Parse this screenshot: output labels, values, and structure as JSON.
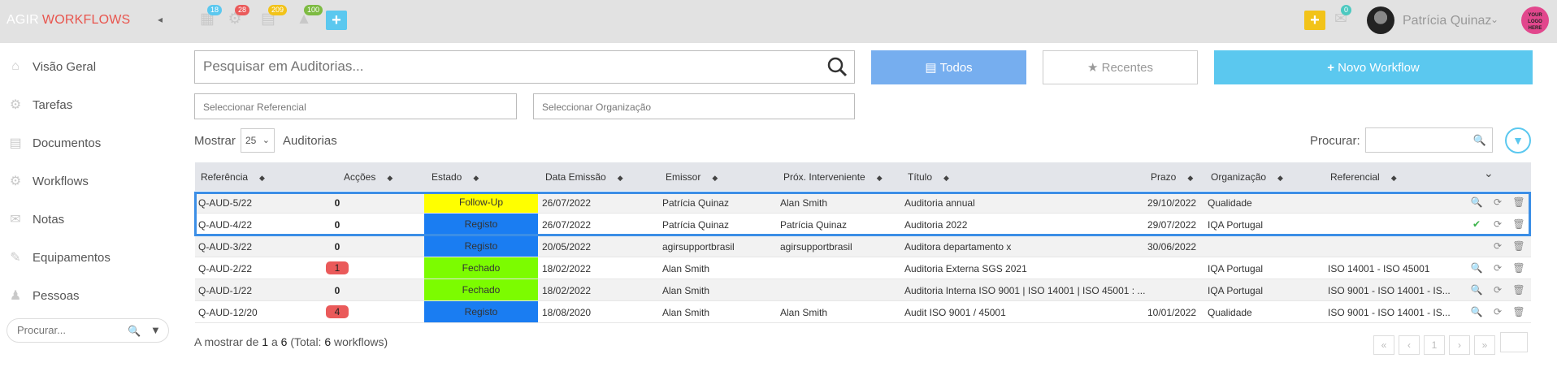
{
  "app": {
    "brand_left": "AGIR",
    "brand_right": "WORKFLOWS",
    "collapse_glyph": "◂"
  },
  "topbar": {
    "icons": [
      {
        "name": "calendar-icon",
        "glyph": "▦",
        "badge": "18",
        "badge_color": "#5bc8ef"
      },
      {
        "name": "gear-icon",
        "glyph": "⚙",
        "badge": "28",
        "badge_color": "#ea5a5a"
      },
      {
        "name": "document-icon",
        "glyph": "▤",
        "badge": "209",
        "badge_color": "#f2c319"
      },
      {
        "name": "bell-icon",
        "glyph": "▲",
        "badge": "100",
        "badge_color": "#7dbb42"
      }
    ],
    "add_glyph": "+",
    "right_add_glyph": "+",
    "mail_badge": "0",
    "user_name": "Patrícia Quinaz",
    "logo_text": "YOUR LOGO HERE"
  },
  "sidebar": {
    "items": [
      {
        "label": "Visão Geral",
        "icon": "home-icon",
        "glyph": "⌂"
      },
      {
        "label": "Tarefas",
        "icon": "gear-icon",
        "glyph": "⚙"
      },
      {
        "label": "Documentos",
        "icon": "file-icon",
        "glyph": "▤"
      },
      {
        "label": "Workflows",
        "icon": "gears-icon",
        "glyph": "⚙"
      },
      {
        "label": "Notas",
        "icon": "comments-icon",
        "glyph": "✉"
      },
      {
        "label": "Equipamentos",
        "icon": "wrench-icon",
        "glyph": "✎"
      },
      {
        "label": "Pessoas",
        "icon": "user-icon",
        "glyph": "♟"
      }
    ],
    "search_placeholder": "Procurar..."
  },
  "toolbar": {
    "search_placeholder": "Pesquisar em Auditorias...",
    "todos_label": "Todos",
    "recentes_label": "Recentes",
    "novo_label": "Novo Workflow",
    "referencial_placeholder": "Seleccionar Referencial",
    "organizacao_placeholder": "Seleccionar Organização"
  },
  "list_controls": {
    "show_label": "Mostrar",
    "page_size": "25",
    "entity_label": "Auditorias",
    "search_label": "Procurar:"
  },
  "table": {
    "headers": [
      "Referência",
      "Acções",
      "Estado",
      "Data Emissão",
      "Emissor",
      "Próx. Interveniente",
      "Título",
      "Prazo",
      "Organização",
      "Referencial"
    ],
    "rows": [
      {
        "ref": "Q-AUD-5/22",
        "acc": "0",
        "acc_red": false,
        "estado": "Follow-Up",
        "estado_color": "#ffff00",
        "data": "26/07/2022",
        "emissor": "Patrícia Quinaz",
        "prox": "Alan Smith",
        "titulo": "Auditoria annual",
        "prazo": "29/10/2022",
        "org": "Qualidade",
        "refer": "",
        "first_action": "🔍"
      },
      {
        "ref": "Q-AUD-4/22",
        "acc": "0",
        "acc_red": false,
        "estado": "Registo",
        "estado_color": "#1a7df2",
        "data": "26/07/2022",
        "emissor": "Patrícia Quinaz",
        "prox": "Patrícia Quinaz",
        "titulo": "Auditoria 2022",
        "prazo": "29/07/2022",
        "org": "IQA Portugal",
        "refer": "",
        "first_action": "✔"
      },
      {
        "ref": "Q-AUD-3/22",
        "acc": "0",
        "acc_red": false,
        "estado": "Registo",
        "estado_color": "#1a7df2",
        "data": "20/05/2022",
        "emissor": "agirsupportbrasil",
        "prox": "agirsupportbrasil",
        "titulo": "Auditora departamento x",
        "prazo": "30/06/2022",
        "org": "",
        "refer": "",
        "first_action": ""
      },
      {
        "ref": "Q-AUD-2/22",
        "acc": "1",
        "acc_red": true,
        "estado": "Fechado",
        "estado_color": "#7cfc00",
        "data": "18/02/2022",
        "emissor": "Alan Smith",
        "prox": "",
        "titulo": "Auditoria Externa SGS 2021",
        "prazo": "",
        "org": "IQA Portugal",
        "refer": "ISO 14001 - ISO 45001",
        "first_action": "🔍"
      },
      {
        "ref": "Q-AUD-1/22",
        "acc": "0",
        "acc_red": false,
        "estado": "Fechado",
        "estado_color": "#7cfc00",
        "data": "18/02/2022",
        "emissor": "Alan Smith",
        "prox": "",
        "titulo": "Auditoria Interna ISO 9001 | ISO 14001 | ISO 45001 : ...",
        "prazo": "",
        "org": "IQA Portugal",
        "refer": "ISO 9001 - ISO 14001 - IS...",
        "first_action": "🔍"
      },
      {
        "ref": "Q-AUD-12/20",
        "acc": "4",
        "acc_red": true,
        "estado": "Registo",
        "estado_color": "#1a7df2",
        "data": "18/08/2020",
        "emissor": "Alan Smith",
        "prox": "Alan Smith",
        "titulo": "Audit ISO 9001 / 45001",
        "prazo": "10/01/2022",
        "org": "Qualidade",
        "refer": "ISO 9001 - ISO 14001 - IS...",
        "first_action": "🔍"
      }
    ]
  },
  "footer": {
    "prefix": "A mostrar de ",
    "from": "1",
    "mid": " a ",
    "to": "6",
    "total_prefix": " (Total: ",
    "total": "6",
    "total_suffix": " workflows)",
    "pager": [
      "«",
      "‹",
      "1",
      "›",
      "»"
    ]
  },
  "colors": {
    "accent_blue": "#76aeef",
    "accent_cyan": "#5bc8ef",
    "brand_red": "#e8554e",
    "selection_border": "#3b8ee6"
  }
}
